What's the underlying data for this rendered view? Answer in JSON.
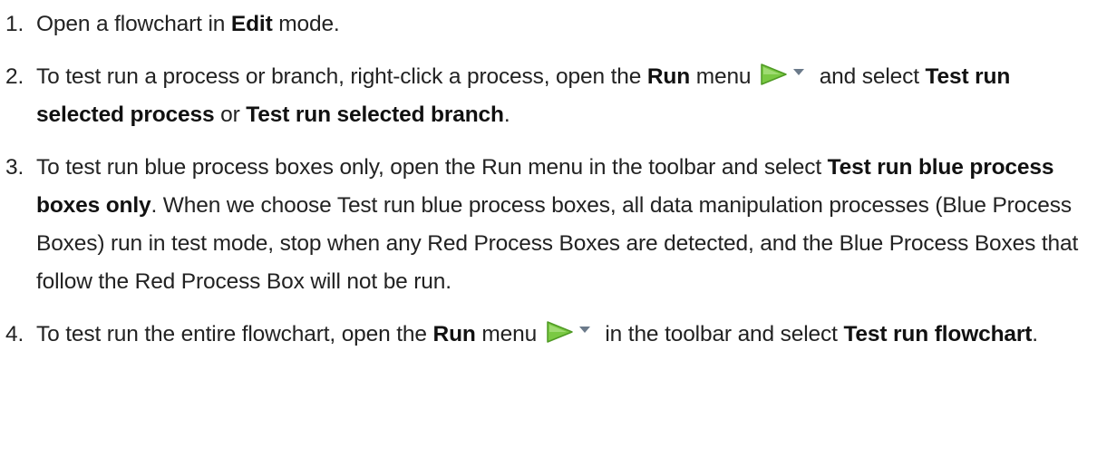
{
  "steps": [
    {
      "number": "1.",
      "t1": "Open a flowchart in ",
      "b1": "Edit",
      "t2": " mode."
    },
    {
      "number": "2.",
      "t1": "To test run a process or branch, right-click a process, open the ",
      "b1": "Run",
      "t2": " menu ",
      "t3": " and select ",
      "b2": "Test run selected process",
      "t4": " or ",
      "b3": "Test run selected branch",
      "t5": "."
    },
    {
      "number": "3.",
      "t1": "To test run blue process boxes only, open the Run menu in the toolbar and select ",
      "b1": "Test run blue process boxes only",
      "t2": ". When we choose Test run blue process boxes, all data manipulation processes (Blue Process Boxes) run in test mode, stop when any Red Process Boxes are detected, and the Blue Process Boxes that follow the Red Process Box will not be run."
    },
    {
      "number": "4.",
      "t1": "To test run the entire flowchart, open the ",
      "b1": "Run",
      "t2": " menu ",
      "t3": " in the toolbar and select ",
      "b2": "Test run flowchart",
      "t4": "."
    }
  ],
  "run_icon": {
    "name": "run-menu-icon",
    "play_color": "#7ac943",
    "play_edge_color": "#4f9a24",
    "arrow_color": "#6b7a8a"
  }
}
